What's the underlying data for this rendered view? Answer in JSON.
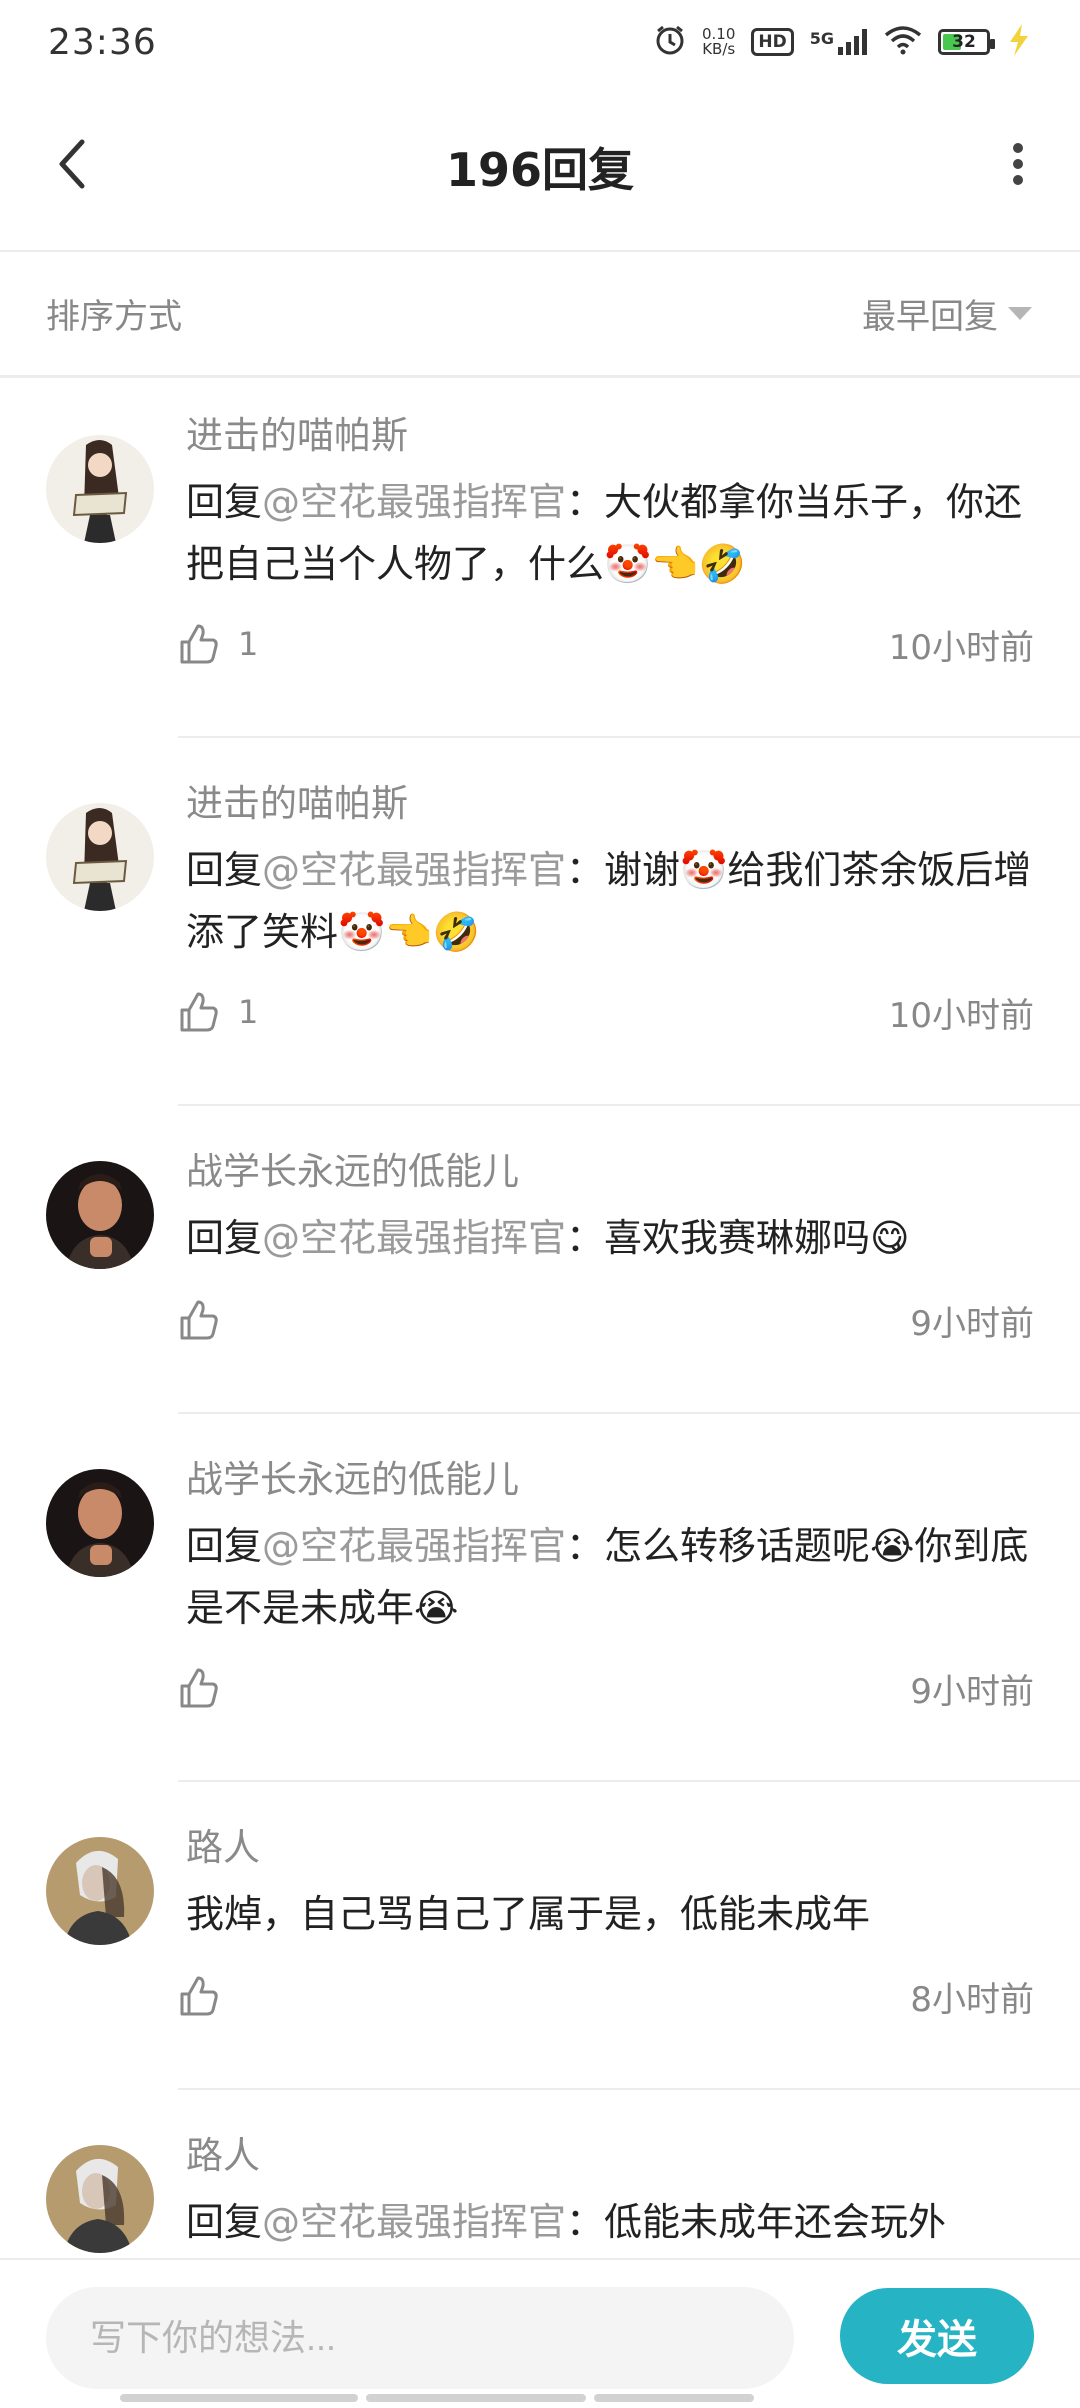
{
  "status_bar": {
    "time": "23:36",
    "net_speed_value": "0.10",
    "net_speed_unit": "KB/s",
    "hd": "HD",
    "network": "5G",
    "battery": "32"
  },
  "header": {
    "title": "196回复"
  },
  "sort": {
    "label": "排序方式",
    "selected": "最早回复"
  },
  "comments": [
    {
      "name": "进击的喵帕斯",
      "prefix": "回复",
      "mention": "@空花最强指挥官",
      "text": "：大伙都拿你当乐子，你还把自己当个人物了，什么🤡👈🤣",
      "likes": "1",
      "time": "10小时前"
    },
    {
      "name": "进击的喵帕斯",
      "prefix": "回复",
      "mention": "@空花最强指挥官",
      "text": "：谢谢🤡给我们茶余饭后增添了笑料🤡👈🤣",
      "likes": "1",
      "time": "10小时前"
    },
    {
      "name": "战学长永远的低能儿",
      "prefix": "回复",
      "mention": "@空花最强指挥官",
      "text": "：喜欢我赛琳娜吗😋",
      "likes": "",
      "time": "9小时前"
    },
    {
      "name": "战学长永远的低能儿",
      "prefix": "回复",
      "mention": "@空花最强指挥官",
      "text": "：怎么转移话题呢😭你到底是不是未成年😭",
      "likes": "",
      "time": "9小时前"
    },
    {
      "name": "路人",
      "prefix": "",
      "mention": "",
      "text": "我焯，自己骂自己了属于是，低能未成年",
      "likes": "",
      "time": "8小时前"
    },
    {
      "name": "路人",
      "prefix": "回复",
      "mention": "@空花最强指挥官",
      "text": "：低能未成年还会玩外",
      "likes": "",
      "time": ""
    }
  ],
  "input": {
    "placeholder": "写下你的想法...",
    "send_label": "发送"
  },
  "colors": {
    "accent": "#26b3c4",
    "muted_text": "#888888",
    "divider": "#ececec"
  }
}
